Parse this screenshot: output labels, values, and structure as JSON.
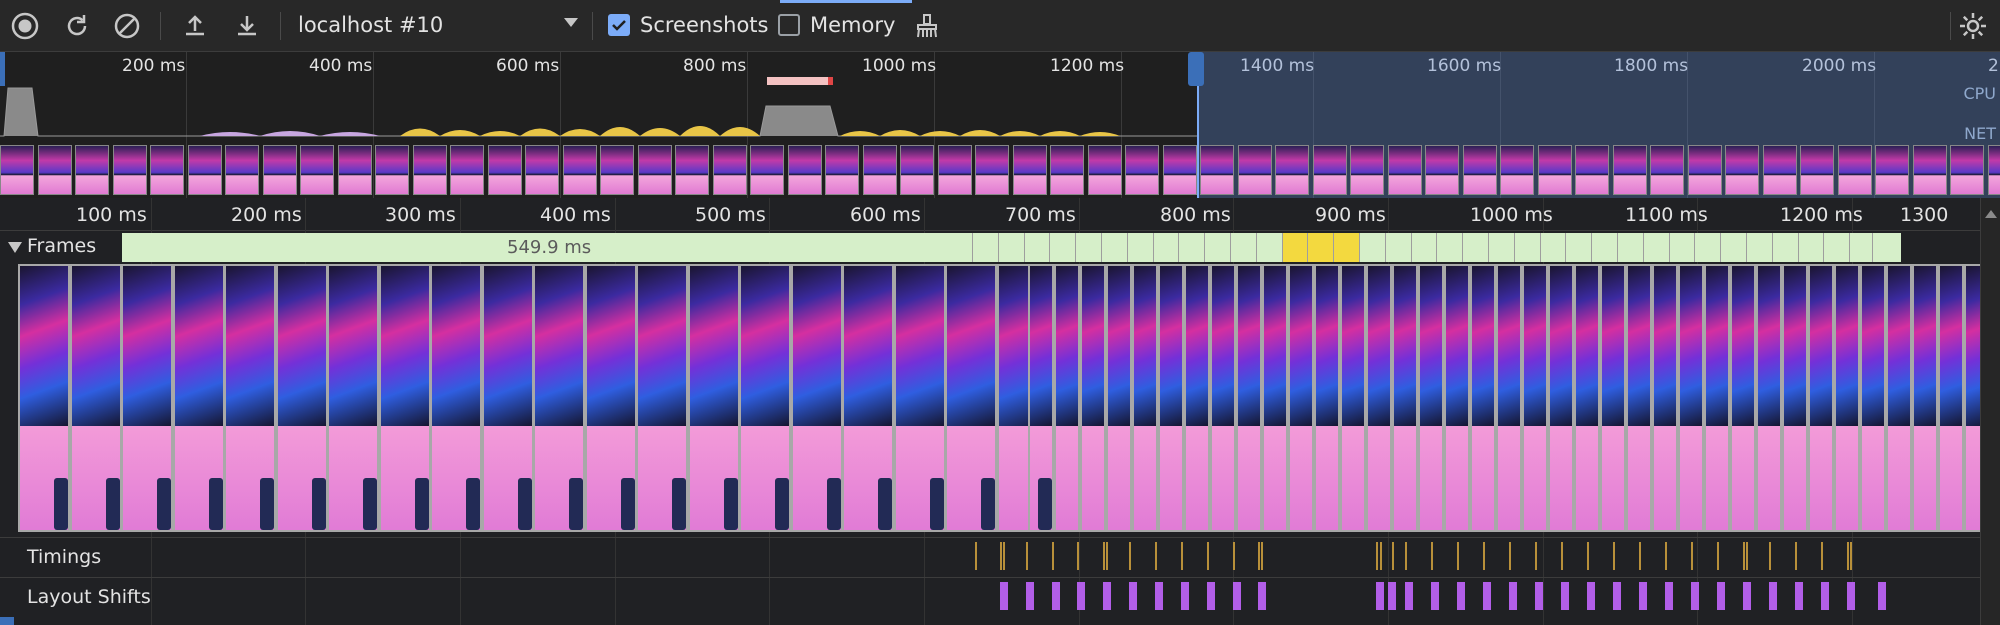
{
  "toolbar": {
    "record_icon": "record-icon",
    "reload_icon": "reload-icon",
    "clear_icon": "clear-icon",
    "upload_icon": "upload-icon",
    "download_icon": "download-icon",
    "target_select": "localhost #10",
    "screenshots_label": "Screenshots",
    "screenshots_checked": true,
    "memory_label": "Memory",
    "memory_checked": false,
    "gc_icon": "broom-icon",
    "settings_icon": "gear-icon"
  },
  "overview": {
    "tick_labels": [
      "200 ms",
      "400 ms",
      "600 ms",
      "800 ms",
      "1000 ms",
      "1200 ms",
      "1400 ms",
      "1600 ms",
      "1800 ms",
      "2000 ms",
      "2"
    ],
    "cpu_label": "CPU",
    "net_label": "NET"
  },
  "ruler": {
    "labels": [
      "100 ms",
      "200 ms",
      "300 ms",
      "400 ms",
      "500 ms",
      "600 ms",
      "700 ms",
      "800 ms",
      "900 ms",
      "1000 ms",
      "1100 ms",
      "1200 ms",
      "1300"
    ]
  },
  "tracks": {
    "frames_label": "Frames",
    "frame_duration": "549.9 ms",
    "timings_label": "Timings",
    "layout_shifts_label": "Layout Shifts"
  },
  "colors": {
    "accent": "#7cacf8",
    "frame_ok": "#d6efc9",
    "frame_janky": "#f3d93f",
    "timing_mark": "#b8903a",
    "layout_shift_mark": "#b25ee8"
  }
}
